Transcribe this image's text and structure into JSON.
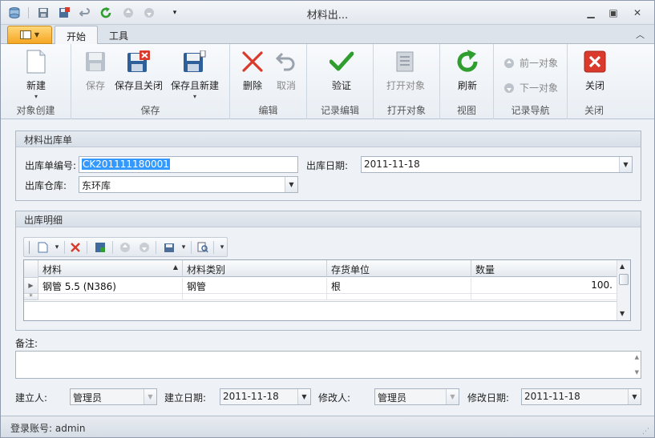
{
  "window": {
    "title": "材料出..."
  },
  "tabs": {
    "home": "开始",
    "tools": "工具"
  },
  "ribbon": {
    "new": "新建",
    "save": "保存",
    "save_close": "保存且关闭",
    "save_new": "保存且新建",
    "delete": "删除",
    "cancel": "取消",
    "validate": "验证",
    "open_object": "打开对象",
    "refresh": "刷新",
    "prev_object": "前一对象",
    "next_object": "下一对象",
    "close": "关闭",
    "groups": {
      "object_create": "对象创建",
      "save": "保存",
      "edit": "编辑",
      "record_edit": "记录编辑",
      "open_object": "打开对象",
      "view": "视图",
      "record_nav": "记录导航",
      "close": "关闭"
    }
  },
  "header_panel": {
    "title": "材料出库单",
    "number_label": "出库单编号:",
    "number_value": "CK201111180001",
    "date_label": "出库日期:",
    "date_value": "2011-11-18",
    "warehouse_label": "出库仓库:",
    "warehouse_value": "东环库"
  },
  "detail_panel": {
    "title": "出库明细",
    "columns": [
      "材料",
      "材料类别",
      "存货单位",
      "数量"
    ],
    "rows": [
      {
        "material": "钢管 5.5 (N386)",
        "category": "钢管",
        "unit": "根",
        "qty": "100."
      }
    ],
    "new_row_marker": "*"
  },
  "remarks": {
    "label": "备注:",
    "value": ""
  },
  "footer_fields": {
    "creator_label": "建立人:",
    "creator_value": "管理员",
    "created_label": "建立日期:",
    "created_value": "2011-11-18",
    "modifier_label": "修改人:",
    "modifier_value": "管理员",
    "modified_label": "修改日期:",
    "modified_value": "2011-11-18"
  },
  "status": {
    "text": "登录账号: admin"
  },
  "colors": {
    "selection": "#3399ff",
    "delete_red": "#d93a2b",
    "ok_green": "#2f9e2f",
    "app_button": "#f5a623"
  }
}
